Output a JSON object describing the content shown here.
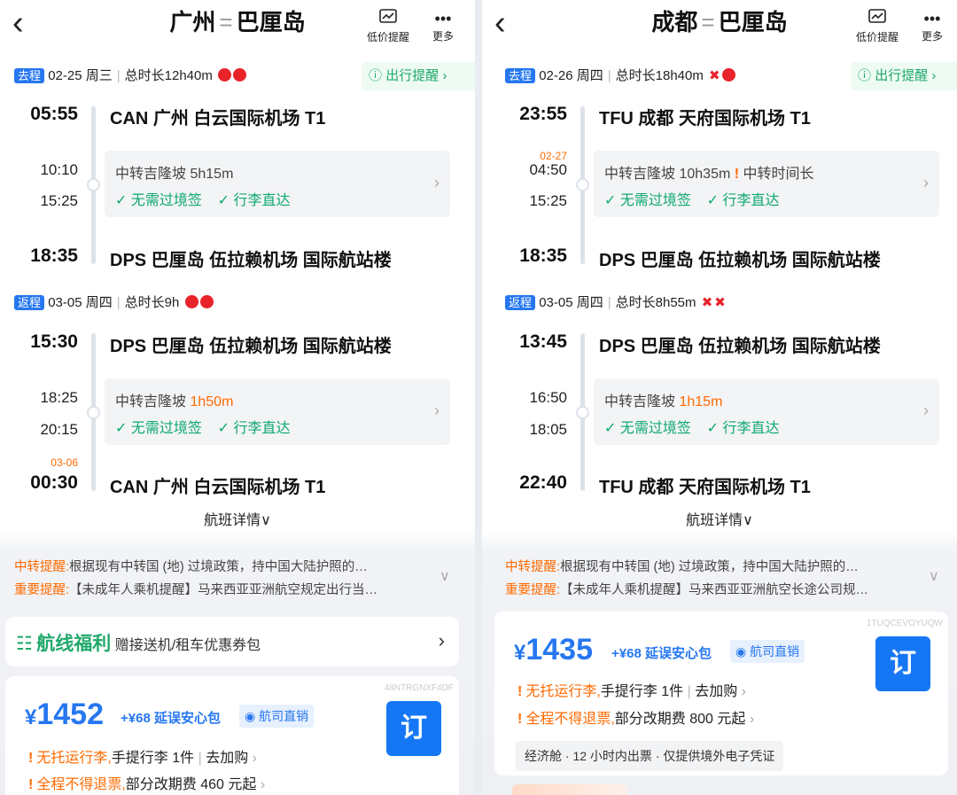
{
  "panels": [
    {
      "header": {
        "origin": "广州",
        "separator": "=",
        "destination": "巴厘岛",
        "low_price_label": "低价提醒",
        "more_label": "更多",
        "back_icon": "back-arrow-icon"
      },
      "notice_chip": "出行提醒",
      "outbound": {
        "tag": "去程",
        "date": "02-25 周三",
        "duration": "总时长12h40m",
        "airline_icons": [
          "airasia-logo",
          "airasia-logo"
        ],
        "dep_time": "05:55",
        "dep_airport": "CAN 广州 白云国际机场 T1",
        "transfer_arr": "10:10",
        "transfer_dep": "15:25",
        "transfer_nextday": "",
        "transfer_text": "中转吉隆坡",
        "transfer_duration": "5h15m",
        "transfer_duration_highlight": false,
        "transfer_warning": "",
        "feature1": "无需过境签",
        "feature2": "行李直达",
        "arr_time": "18:35",
        "arr_nextday": "",
        "arr_airport": "DPS 巴厘岛 伍拉赖机场 国际航站楼"
      },
      "return": {
        "tag": "返程",
        "date": "03-05 周四",
        "duration": "总时长9h",
        "airline_icons": [
          "airasia-logo",
          "airasia-logo"
        ],
        "dep_time": "15:30",
        "dep_airport": "DPS 巴厘岛 伍拉赖机场 国际航站楼",
        "transfer_arr": "18:25",
        "transfer_dep": "20:15",
        "transfer_nextday": "",
        "transfer_text": "中转吉隆坡",
        "transfer_duration": "1h50m",
        "transfer_duration_highlight": true,
        "transfer_warning": "",
        "feature1": "无需过境签",
        "feature2": "行李直达",
        "arr_time": "00:30",
        "arr_nextday": "03-06",
        "arr_airport": "CAN 广州 白云国际机场 T1"
      },
      "detail_link": "航班详情",
      "tips": {
        "transfer_label": "中转提醒:",
        "transfer_text": "根据现有中转国 (地) 过境政策，持中国大陆护照的…",
        "important_label": "重要提醒:",
        "important_text": "【未成年人乘机提醒】马来西亚亚洲航空规定出行当…"
      },
      "welfare": {
        "title": "航线福利",
        "text": "赠接送机/租车优惠券包"
      },
      "offer": {
        "code": "48NTRGNXF4DF",
        "currency": "¥",
        "price": "1452",
        "package": "+¥68 延误安心包",
        "direct": "航司直销",
        "book": "订",
        "baggage_hl": "无托运行李,",
        "baggage_text": "手提行李 1件",
        "baggage_link": "去加购",
        "refund_hl": "全程不得退票,",
        "refund_text": "部分改期费 460 元起"
      }
    },
    {
      "header": {
        "origin": "成都",
        "separator": "=",
        "destination": "巴厘岛",
        "low_price_label": "低价提醒",
        "more_label": "更多",
        "back_icon": "back-arrow-icon"
      },
      "notice_chip": "出行提醒",
      "outbound": {
        "tag": "去程",
        "date": "02-26 周四",
        "duration": "总时长18h40m",
        "airline_icons": [
          "sichuan-airlines-logo",
          "airasia-logo"
        ],
        "dep_time": "23:55",
        "dep_airport": "TFU 成都 天府国际机场 T1",
        "transfer_arr": "04:50",
        "transfer_dep": "15:25",
        "transfer_nextday": "02-27",
        "transfer_text": "中转吉隆坡",
        "transfer_duration": "10h35m",
        "transfer_duration_highlight": false,
        "transfer_warning": "中转时间长",
        "feature1": "无需过境签",
        "feature2": "行李直达",
        "arr_time": "18:35",
        "arr_nextday": "",
        "arr_airport": "DPS 巴厘岛 伍拉赖机场 国际航站楼"
      },
      "return": {
        "tag": "返程",
        "date": "03-05 周四",
        "duration": "总时长8h55m",
        "airline_icons": [
          "sichuan-airlines-logo",
          "sichuan-airlines-logo"
        ],
        "dep_time": "13:45",
        "dep_airport": "DPS 巴厘岛 伍拉赖机场 国际航站楼",
        "transfer_arr": "16:50",
        "transfer_dep": "18:05",
        "transfer_nextday": "",
        "transfer_text": "中转吉隆坡",
        "transfer_duration": "1h15m",
        "transfer_duration_highlight": true,
        "transfer_warning": "",
        "feature1": "无需过境签",
        "feature2": "行李直达",
        "arr_time": "22:40",
        "arr_nextday": "",
        "arr_airport": "TFU 成都 天府国际机场 T1"
      },
      "detail_link": "航班详情",
      "tips": {
        "transfer_label": "中转提醒:",
        "transfer_text": "根据现有中转国 (地) 过境政策，持中国大陆护照的…",
        "important_label": "重要提醒:",
        "important_text": "【未成年人乘机提醒】马来西亚亚洲航空长途公司规…"
      },
      "offer": {
        "code": "1TUQCEVOYUQW",
        "currency": "¥",
        "price": "1435",
        "package": "+¥68 延误安心包",
        "direct": "航司直销",
        "book": "订",
        "baggage_hl": "无托运行李,",
        "baggage_text": "手提行李 1件",
        "baggage_link": "去加购",
        "refund_hl": "全程不得退票,",
        "refund_text": "部分改期费 800 元起",
        "cabin": "经济舱 · 12 小时内出票 · 仅提供境外电子凭证"
      }
    }
  ],
  "colors": {
    "accent": "#2677f0",
    "orange": "#ff6a00",
    "green": "#0ea970",
    "airline_red": "#e8232a"
  }
}
